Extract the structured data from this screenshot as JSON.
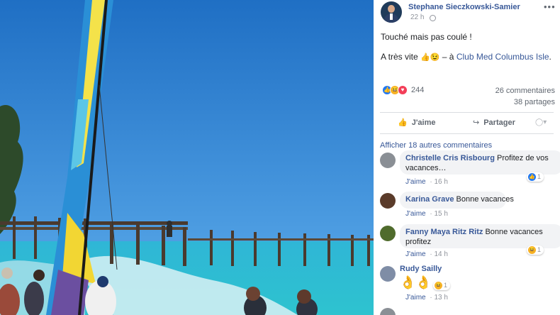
{
  "post": {
    "author": "Stephane Sieczkowski-Samier",
    "time": "22 h",
    "more": "•••",
    "text_line1": "Touché mais pas coulé !",
    "text_line2_prefix": "A très vite",
    "text_line2_emojis": "👍😉",
    "text_line2_sep": "– à",
    "location": "Club Med Columbus Isle",
    "text_line2_end": ".",
    "reaction_count": "244",
    "comments": "26 commentaires",
    "shares": "38 partages"
  },
  "actions": {
    "like": "J'aime",
    "share": "Partager"
  },
  "more_comments": "Afficher 18 autres commentaires",
  "comments": [
    {
      "name": "Christelle Cris Risbourg",
      "text_a": "Profitez de vos",
      "text_b": "vacances…",
      "like": "J'aime",
      "sep": "·",
      "time": "16 h",
      "reaction_count": "1",
      "colors": {
        "avatar": "#8a8f95"
      }
    },
    {
      "name": "Karina Grave",
      "text_a": "Bonne vacances",
      "like": "J'aime",
      "sep": "·",
      "time": "15 h",
      "colors": {
        "avatar": "#5a3b2a"
      }
    },
    {
      "name": "Fanny Maya Ritz Ritz",
      "text_a": "Bonne vacances",
      "text_b": "profitez",
      "like": "J'aime",
      "sep": "·",
      "time": "14 h",
      "reaction_count": "1",
      "colors": {
        "avatar": "#4f6b2c"
      }
    },
    {
      "name": "Rudy Sailly",
      "text_a": "👌👌",
      "like": "J'aime",
      "sep": "·",
      "time": "13 h",
      "reaction_count": "1",
      "colors": {
        "avatar": "#7f8da6"
      }
    }
  ],
  "colors": {
    "link": "#385898",
    "like_reaction": "#2078f4",
    "haha_reaction": "#f7b125",
    "love_reaction": "#f33e58"
  }
}
